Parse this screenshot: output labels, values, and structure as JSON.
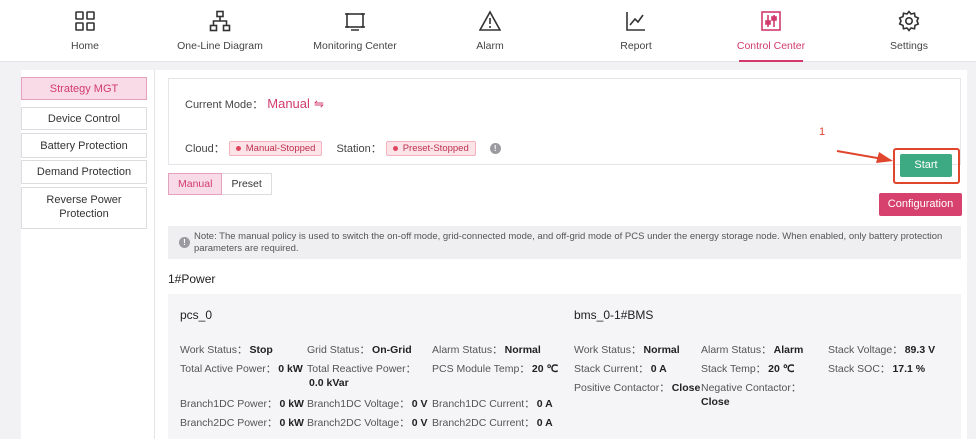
{
  "nav": {
    "items": [
      {
        "label": "Home",
        "icon": "grid-icon"
      },
      {
        "label": "One-Line Diagram",
        "icon": "hierarchy-icon"
      },
      {
        "label": "Monitoring Center",
        "icon": "monitor-icon"
      },
      {
        "label": "Alarm",
        "icon": "warning-icon"
      },
      {
        "label": "Report",
        "icon": "line-chart-icon"
      },
      {
        "label": "Control Center",
        "icon": "sliders-icon",
        "active": true
      },
      {
        "label": "Settings",
        "icon": "gear-icon"
      }
    ]
  },
  "sidebar": {
    "items": [
      {
        "label": "Strategy MGT",
        "active": true
      },
      {
        "label": "Device Control"
      },
      {
        "label": "Battery Protection"
      },
      {
        "label": "Demand Protection"
      },
      {
        "label": "Reverse Power Protection"
      }
    ]
  },
  "mode": {
    "label": "Current Mode：",
    "value": "Manual",
    "swap_icon": "⇋"
  },
  "status": {
    "cloud_label": "Cloud：",
    "cloud_value": "Manual-Stopped",
    "station_label": "Station：",
    "station_value": "Preset-Stopped"
  },
  "annotation": {
    "number": "1"
  },
  "start_label": "Start",
  "tabs": [
    {
      "label": "Manual",
      "active": true
    },
    {
      "label": "Preset"
    }
  ],
  "config_label": "Configuration",
  "note": "Note: The manual policy is used to switch the on-off mode, grid-connected mode, and off-grid mode of PCS under the energy storage node. When enabled, only battery protection parameters are required.",
  "section_title": "1#Power",
  "pcs": {
    "title": "pcs_0",
    "fields": [
      {
        "label": "Work Status：",
        "value": "Stop"
      },
      {
        "label": "Grid Status：",
        "value": "On-Grid"
      },
      {
        "label": "Alarm Status：",
        "value": "Normal"
      },
      {
        "label": "Total Active Power：",
        "value": "0 kW"
      },
      {
        "label": "Total Reactive Power：",
        "value": "0.0 kVar"
      },
      {
        "label": "PCS Module Temp：",
        "value": "20 ℃"
      },
      {
        "label": "Branch1DC Power：",
        "value": "0 kW"
      },
      {
        "label": "Branch1DC Voltage：",
        "value": "0 V"
      },
      {
        "label": "Branch1DC Current：",
        "value": "0 A"
      },
      {
        "label": "Branch2DC Power：",
        "value": "0 kW"
      },
      {
        "label": "Branch2DC Voltage：",
        "value": "0 V"
      },
      {
        "label": "Branch2DC Current：",
        "value": "0 A"
      }
    ]
  },
  "bms": {
    "title": "bms_0-1#BMS",
    "fields": [
      {
        "label": "Work Status：",
        "value": "Normal"
      },
      {
        "label": "Alarm Status：",
        "value": "Alarm"
      },
      {
        "label": "Stack Voltage：",
        "value": "89.3 V"
      },
      {
        "label": "Stack Current：",
        "value": "0 A"
      },
      {
        "label": "Stack Temp：",
        "value": "20 ℃"
      },
      {
        "label": "Stack SOC：",
        "value": "17.1 %"
      },
      {
        "label": "Positive Contactor：",
        "value": "Close"
      },
      {
        "label": "Negative Contactor：",
        "value": "Close"
      }
    ]
  },
  "colors": {
    "accent": "#d23a6e",
    "start_button": "#3daa83",
    "annotation": "#e0452e"
  }
}
